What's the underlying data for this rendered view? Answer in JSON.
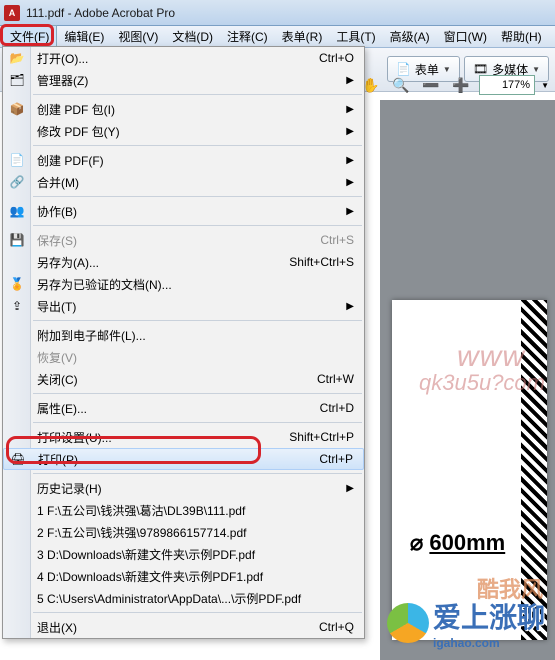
{
  "titlebar": {
    "title": "111.pdf - Adobe Acrobat Pro",
    "app_icon_label": "A"
  },
  "menubar": {
    "items": [
      {
        "label": "文件(F)"
      },
      {
        "label": "编辑(E)"
      },
      {
        "label": "视图(V)"
      },
      {
        "label": "文档(D)"
      },
      {
        "label": "注释(C)"
      },
      {
        "label": "表单(R)"
      },
      {
        "label": "工具(T)"
      },
      {
        "label": "高级(A)"
      },
      {
        "label": "窗口(W)"
      },
      {
        "label": "帮助(H)"
      }
    ]
  },
  "toolbar": {
    "forms_label": "表单",
    "multimedia_label": "多媒体",
    "zoom_value": "177%"
  },
  "file_menu": {
    "open": {
      "label": "打开(O)...",
      "shortcut": "Ctrl+O"
    },
    "organizer": {
      "label": "管理器(Z)"
    },
    "create_pkg": {
      "label": "创建 PDF 包(I)"
    },
    "modify_pkg": {
      "label": "修改 PDF 包(Y)"
    },
    "create_pdf": {
      "label": "创建 PDF(F)"
    },
    "combine": {
      "label": "合并(M)"
    },
    "collaborate": {
      "label": "协作(B)"
    },
    "save": {
      "label": "保存(S)",
      "shortcut": "Ctrl+S"
    },
    "save_as": {
      "label": "另存为(A)...",
      "shortcut": "Shift+Ctrl+S"
    },
    "save_certified": {
      "label": "另存为已验证的文档(N)..."
    },
    "export": {
      "label": "导出(T)"
    },
    "attach_email": {
      "label": "附加到电子邮件(L)..."
    },
    "revert": {
      "label": "恢复(V)"
    },
    "close": {
      "label": "关闭(C)",
      "shortcut": "Ctrl+W"
    },
    "properties": {
      "label": "属性(E)...",
      "shortcut": "Ctrl+D"
    },
    "print_setup": {
      "label": "打印设置(U)...",
      "shortcut": "Shift+Ctrl+P"
    },
    "print": {
      "label": "打印(P)...",
      "shortcut": "Ctrl+P"
    },
    "history": {
      "label": "历史记录(H)"
    },
    "recent": [
      {
        "label": "1 F:\\五公司\\钱洪强\\葛沽\\DL39B\\111.pdf"
      },
      {
        "label": "2 F:\\五公司\\钱洪强\\9789866157714.pdf"
      },
      {
        "label": "3 D:\\Downloads\\新建文件夹\\示例PDF.pdf"
      },
      {
        "label": "4 D:\\Downloads\\新建文件夹\\示例PDF1.pdf"
      },
      {
        "label": "5 C:\\Users\\Administrator\\AppData\\...\\示例PDF.pdf"
      }
    ],
    "exit": {
      "label": "退出(X)",
      "shortcut": "Ctrl+Q"
    }
  },
  "document": {
    "dimension_text": "600mm",
    "phi": "⌀"
  },
  "watermarks": {
    "w1a": "www",
    "w1b": "qk3u5u?com",
    "w2_text": "爱上涨聊",
    "w2_domain": "igahao.com",
    "w3": "酷我风"
  }
}
